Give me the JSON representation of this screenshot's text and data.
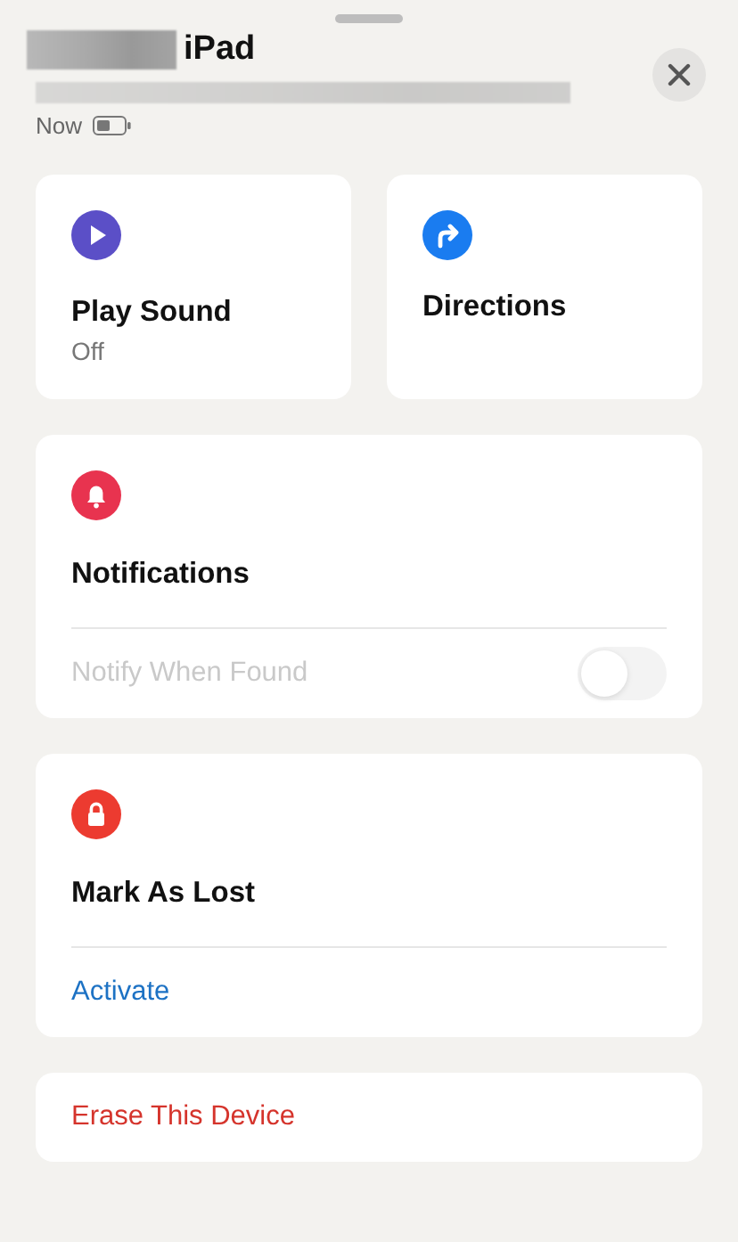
{
  "header": {
    "title": "iPad",
    "updated": "Now",
    "name_redacted": true,
    "address_redacted": true
  },
  "actions": [
    {
      "kind": "sound",
      "label": "Play Sound",
      "status": "Off"
    },
    {
      "kind": "directions",
      "label": "Directions"
    }
  ],
  "notifications": {
    "title": "Notifications",
    "option": {
      "label": "Notify When Found",
      "on": false,
      "disabled": true
    }
  },
  "lost_mode": {
    "title": "Mark As Lost",
    "link": "Activate"
  },
  "erase": {
    "label": "Erase This Device"
  }
}
